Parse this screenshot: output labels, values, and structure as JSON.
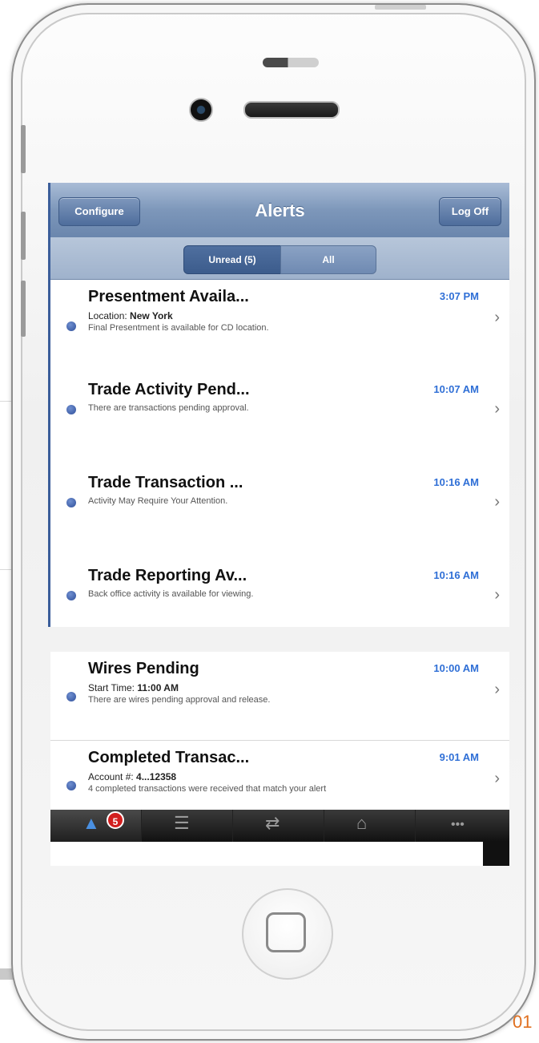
{
  "nav": {
    "configure_label": "Configure",
    "title": "Alerts",
    "logoff_label": "Log Off"
  },
  "segments": {
    "unread_label": "Unread (5)",
    "all_label": "All"
  },
  "alerts": [
    {
      "title": "Presentment Availa...",
      "time": "3:07 PM",
      "line1_prefix": "Location: ",
      "line1_value": "New York",
      "line2": "Final Presentment is available for CD location."
    },
    {
      "title": "Trade Activity Pend...",
      "time": "10:07 AM",
      "line1_prefix": "",
      "line1_value": "",
      "line2": "There are transactions pending approval."
    },
    {
      "title": "Trade Transaction ...",
      "time": "10:16 AM",
      "line1_prefix": "",
      "line1_value": "",
      "line2": "Activity May Require Your Attention."
    },
    {
      "title": "Trade Reporting Av...",
      "time": "10:16 AM",
      "line1_prefix": "",
      "line1_value": "",
      "line2": "Back office activity is available for viewing."
    },
    {
      "title": "Wires Pending",
      "time": "10:00 AM",
      "line1_prefix": "Start Time: ",
      "line1_value": "11:00 AM",
      "line2": "There are wires pending approval and release."
    },
    {
      "title": "Completed Transac...",
      "time": "9:01 AM",
      "line1_prefix": "Account #: ",
      "line1_value": "4...12358",
      "line2": "4 completed transactions were received that match your alert"
    }
  ],
  "tabbar": {
    "badge": "5",
    "icons": [
      "bell-icon",
      "list-icon",
      "transfer-icon",
      "bank-icon",
      "more-icon"
    ]
  },
  "corner_text": "01",
  "colors": {
    "nav_blue": "#6a86ad",
    "time_blue": "#2f6fd6",
    "badge_red": "#d21f1f"
  }
}
